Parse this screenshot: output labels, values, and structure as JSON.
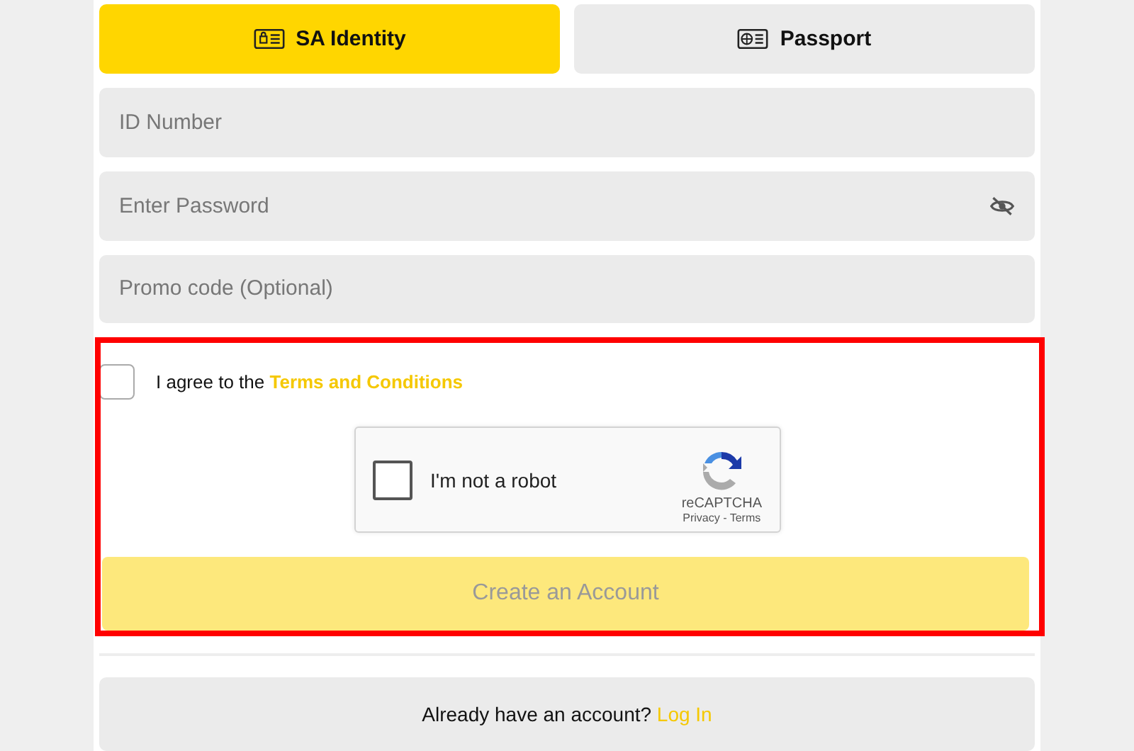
{
  "id_tabs": [
    {
      "kind": "id-card",
      "label": "SA Identity",
      "selected": true
    },
    {
      "kind": "passport",
      "label": "Passport",
      "selected": false
    }
  ],
  "fields": [
    {
      "placeholder": "ID Number",
      "kind": "text"
    },
    {
      "placeholder": "Enter Password",
      "kind": "password"
    },
    {
      "placeholder": "Promo code (Optional)",
      "kind": "text"
    }
  ],
  "terms": {
    "checked": false,
    "text": "I agree to the ",
    "link": "Terms and Conditions"
  },
  "captcha": {
    "checked": false,
    "label": "I'm not a robot",
    "brand": "reCAPTCHA",
    "privacy": "Privacy",
    "separator": " - ",
    "terms": "Terms"
  },
  "submit": {
    "label": "Create an Account",
    "disabled": true
  },
  "login_prompt": {
    "text": "Already have an account? ",
    "link": "Log In"
  }
}
